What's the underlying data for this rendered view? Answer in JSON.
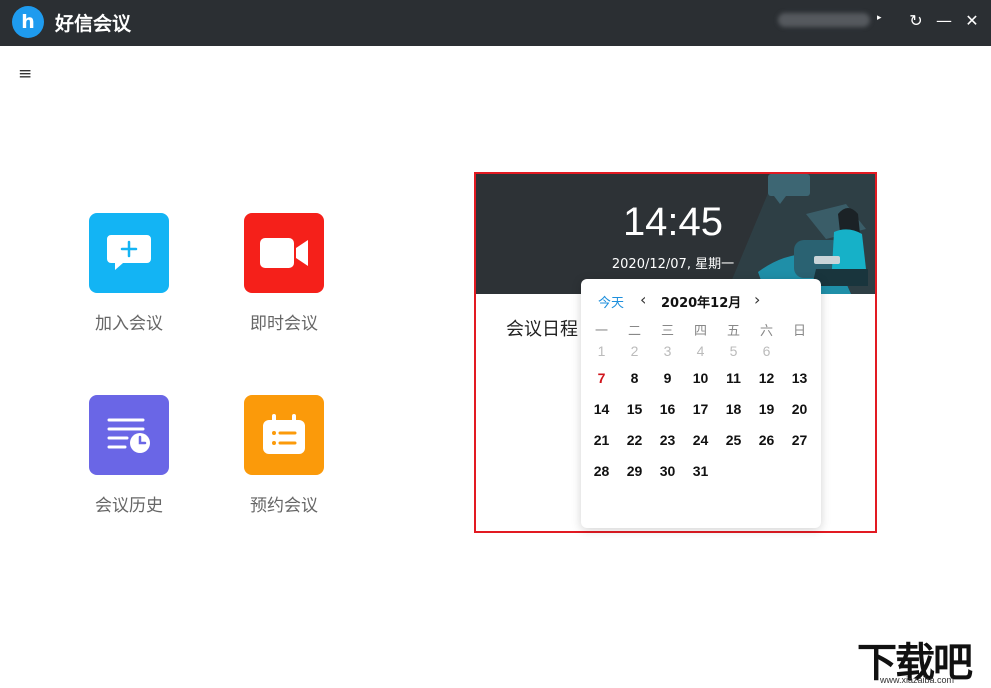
{
  "titlebar": {
    "logo_glyph": "h",
    "app_title": "好信会议",
    "caret": "▸",
    "refresh_glyph": "↻",
    "minimize_glyph": "—",
    "close_glyph": "✕",
    "menu_glyph": "≡"
  },
  "actions": [
    {
      "label": "加入会议",
      "color": "#13b4f4",
      "icon": "chat-plus-icon"
    },
    {
      "label": "即时会议",
      "color": "#f5201a",
      "icon": "video-camera-icon"
    },
    {
      "label": "会议历史",
      "color": "#6a66e6",
      "icon": "history-list-icon"
    },
    {
      "label": "预约会议",
      "color": "#fb9a0a",
      "icon": "calendar-list-icon"
    }
  ],
  "panel": {
    "time": "14:45",
    "date": "2020/12/07, 星期一",
    "schedule_label": "会议日程"
  },
  "calendar": {
    "today_label": "今天",
    "prev_glyph": "‹",
    "next_glyph": "›",
    "month_title": "2020年12月",
    "weekdays": [
      "一",
      "二",
      "三",
      "四",
      "五",
      "六",
      "日"
    ],
    "dim_row": [
      "1",
      "2",
      "3",
      "4",
      "5",
      "6"
    ],
    "rows": [
      [
        "7",
        "8",
        "9",
        "10",
        "11",
        "12",
        "13"
      ],
      [
        "14",
        "15",
        "16",
        "17",
        "18",
        "19",
        "20"
      ],
      [
        "21",
        "22",
        "23",
        "24",
        "25",
        "26",
        "27"
      ],
      [
        "28",
        "29",
        "30",
        "31",
        "",
        "",
        ""
      ]
    ]
  },
  "watermark": {
    "text": "下载吧",
    "url": "www.xiazaiba.com"
  }
}
